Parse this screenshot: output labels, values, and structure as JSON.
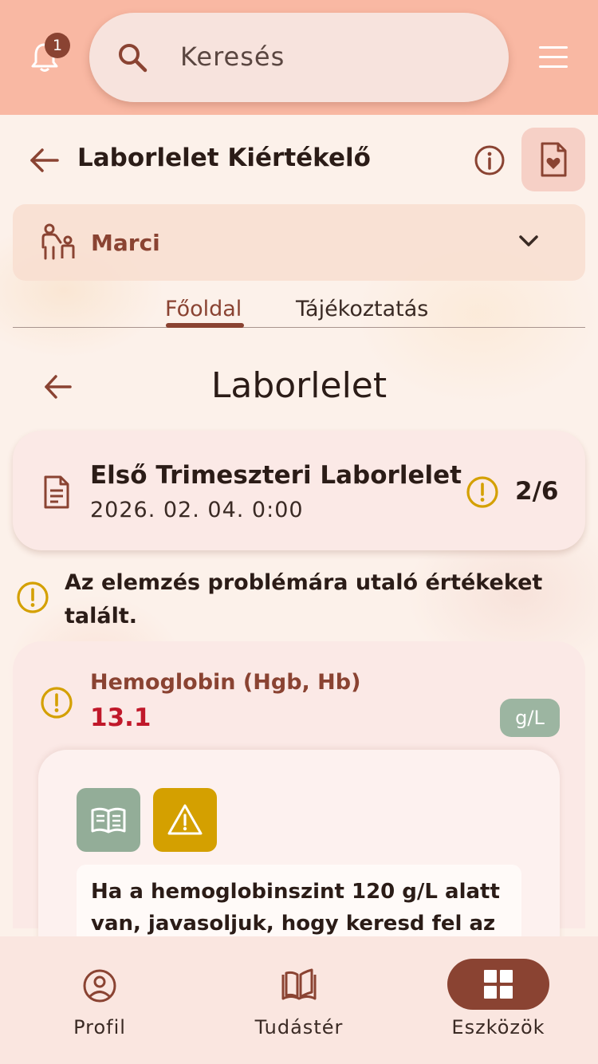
{
  "header": {
    "notification_count": "1",
    "search_placeholder": "Keresés"
  },
  "page": {
    "title": "Laborlelet Kiértékelő"
  },
  "patient": {
    "name": "Marci"
  },
  "tabs": [
    {
      "label": "Főoldal",
      "active": true
    },
    {
      "label": "Tájékoztatás",
      "active": false
    }
  ],
  "section": {
    "title": "Laborlelet"
  },
  "lab_card": {
    "title": "Első Trimeszteri Laborlelet",
    "date": "2026. 02. 04. 0:00",
    "count": "2/6"
  },
  "warning_message": "Az elemzés problémára utaló értékeket talált.",
  "result": {
    "name": "Hemoglobin (Hgb, Hb)",
    "value": "13.1",
    "unit": "g/L",
    "advice_text": "Ha a hemoglobinszint 120 g/L alatt van, javasoljuk, hogy keresd fel az"
  },
  "bottom_nav": [
    {
      "label": "Profil",
      "icon": "profile-icon",
      "active": false
    },
    {
      "label": "Tudástér",
      "icon": "book-icon",
      "active": false
    },
    {
      "label": "Eszközök",
      "icon": "grid-icon",
      "active": true
    }
  ],
  "colors": {
    "topbar": "#f9b8a3",
    "brand": "#8a4332",
    "warning": "#d4a000",
    "danger_value": "#c0182a",
    "sage": "#9cb5a1"
  }
}
